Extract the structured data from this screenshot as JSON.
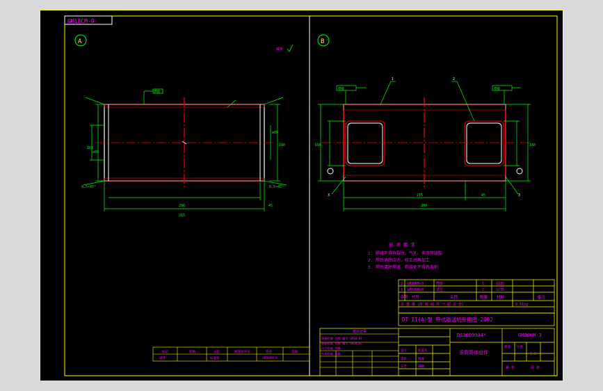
{
  "drawing": {
    "code_box": "GM18CM-9",
    "view_a_label": "A",
    "view_b_label": "B",
    "roughness_note": "其余",
    "view_a": {
      "dim_total_length": "315",
      "dim_inner_length": "290",
      "dim_left_offset": "45",
      "dim_right_offset": "45",
      "dim_left_height": "160",
      "dim_right_height": "160",
      "dim_left_dia": "∅80",
      "dim_right_dia": "∅80",
      "weld_symbol": "焊接",
      "chamfer_left": "0.5×45°",
      "chamfer_right": "0.5×45°"
    },
    "view_b": {
      "dim_total_length": "300",
      "dim_inner_length": "215",
      "dim_right_offset": "45",
      "dim_left_height": "160",
      "dim_right_height": "160",
      "left_symbol": "焊接",
      "right_symbol": "焊接",
      "callout_1": "1",
      "callout_2": "2",
      "callout_3_left": "3",
      "callout_3_right": "3"
    },
    "tech_requirements": {
      "title": "技 术 要 求",
      "lines": [
        "1. 焊缝不得有裂纹、气孔、夹渣等缺陷",
        "2. 焊后消除应力，校正后再加工",
        "3. 焊后清除焊渣，焊接处不得有毛刺"
      ]
    },
    "parts_table": {
      "rows": [
        [
          "2",
          "GM30KM-9",
          "筒体",
          "1",
          "Q235",
          ""
        ],
        [
          "1",
          "GM30KM-8",
          "法兰",
          "2",
          "Q235",
          ""
        ]
      ],
      "header": [
        "序号",
        "代号",
        "名称",
        "数量",
        "材料",
        "备注"
      ],
      "info_row": "总 重 量 (所 有 组 件 一 起 总 计)",
      "weight": "8.61kg"
    },
    "title_block": {
      "main_title": "DT II(A)型 带式输送机专用图-2002",
      "drawing_no": "DS30D99A4*",
      "part_code": "GM30KM-3",
      "part_name": "滚筒筒体组件",
      "revision_label": "更改",
      "scale_label": "比例",
      "scale": "1:2",
      "sheet_label": "第 张",
      "sheets_label": "共 张",
      "rows": [
        [
          "设计",
          "",
          "标准化",
          ""
        ],
        [
          "审核",
          "",
          "批准",
          ""
        ],
        [
          "工艺",
          "",
          "日期",
          ""
        ]
      ]
    },
    "revision_block": {
      "header": [
        "标记",
        "处数",
        "分区",
        "更改文件号",
        "签名",
        "日期"
      ],
      "row": [
        "设计",
        "",
        "标准化",
        "",
        "GM30KM-9",
        ""
      ]
    },
    "signature_block": {
      "title": "校对记录",
      "lines": [
        "焊缝检查 合格 编号 GM30-01",
        "装配检查 合格 编号 GM30-02",
        "尺寸检查 合格",
        "外观检查 合格"
      ]
    }
  },
  "colors": {
    "border": "#ffff00",
    "geometry": "#ffffff",
    "dimensions": "#00ff00",
    "centerline": "#ff0000",
    "text": "#ff00ff",
    "hatch": "#ff0000"
  }
}
